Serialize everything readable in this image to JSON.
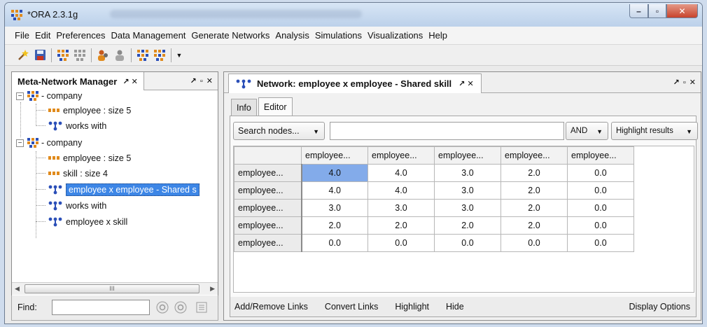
{
  "window": {
    "title": "*ORA 2.3.1g",
    "controls": {
      "minimize": "–",
      "maximize": "▫",
      "close": "✕"
    }
  },
  "menu": [
    "File",
    "Edit",
    "Preferences",
    "Data Management",
    "Generate Networks",
    "Analysis",
    "Simulations",
    "Visualizations",
    "Help"
  ],
  "toolbar": {
    "icons": [
      "wand-icon",
      "save-icon",
      "network-icon",
      "nodeset-icon",
      "agent-icon",
      "agent-gray-icon",
      "network-compare-icon",
      "network-alt-icon",
      "dropdown-arrow-icon"
    ]
  },
  "left_panel": {
    "title": "Meta-Network Manager",
    "tab_controls": "↗ ✕",
    "pane_controls": "↗ ▫ ✕",
    "tree": [
      {
        "label": "- company",
        "type": "metanetwork",
        "level": 0,
        "expander": "−"
      },
      {
        "label": "employee : size 5",
        "type": "nodeset",
        "level": 1
      },
      {
        "label": "works with",
        "type": "network",
        "level": 1
      },
      {
        "label": "- company",
        "type": "metanetwork",
        "level": 0,
        "expander": "−"
      },
      {
        "label": "employee : size 5",
        "type": "nodeset",
        "level": 1
      },
      {
        "label": "skill : size 4",
        "type": "nodeset",
        "level": 1
      },
      {
        "label": "employee x employee - Shared s",
        "type": "network",
        "level": 1,
        "selected": true
      },
      {
        "label": "works with",
        "type": "network",
        "level": 1
      },
      {
        "label": "employee x skill",
        "type": "network",
        "level": 1
      }
    ],
    "scroll_grip": "III",
    "find_label": "Find:",
    "find_value": ""
  },
  "right_panel": {
    "title": "Network: employee x employee - Shared skill",
    "tab_controls": "↗ ✕",
    "pane_controls": "↗ ▫ ✕",
    "tabs": [
      "Info",
      "Editor"
    ],
    "active_tab": "Editor",
    "search": {
      "mode_label": "Search nodes...",
      "query": "",
      "operator": "AND",
      "action": "Highlight results"
    },
    "matrix": {
      "column_headers": [
        "employee...",
        "employee...",
        "employee...",
        "employee...",
        "employee..."
      ],
      "row_headers": [
        "employee...",
        "employee...",
        "employee...",
        "employee...",
        "employee..."
      ],
      "rows": [
        [
          "4.0",
          "4.0",
          "3.0",
          "2.0",
          "0.0"
        ],
        [
          "4.0",
          "4.0",
          "3.0",
          "2.0",
          "0.0"
        ],
        [
          "3.0",
          "3.0",
          "3.0",
          "2.0",
          "0.0"
        ],
        [
          "2.0",
          "2.0",
          "2.0",
          "2.0",
          "0.0"
        ],
        [
          "0.0",
          "0.0",
          "0.0",
          "0.0",
          "0.0"
        ]
      ],
      "selected_cell": [
        0,
        0
      ]
    },
    "bottom_links": [
      "Add/Remove Links",
      "Convert Links",
      "Highlight",
      "Hide"
    ],
    "display_options": "Display Options"
  },
  "colors": {
    "selection": "#3d86e6",
    "cell_selection": "#83abea",
    "network_icon": "#2b4fb8",
    "nodeset_icon": "#e08a1c"
  }
}
